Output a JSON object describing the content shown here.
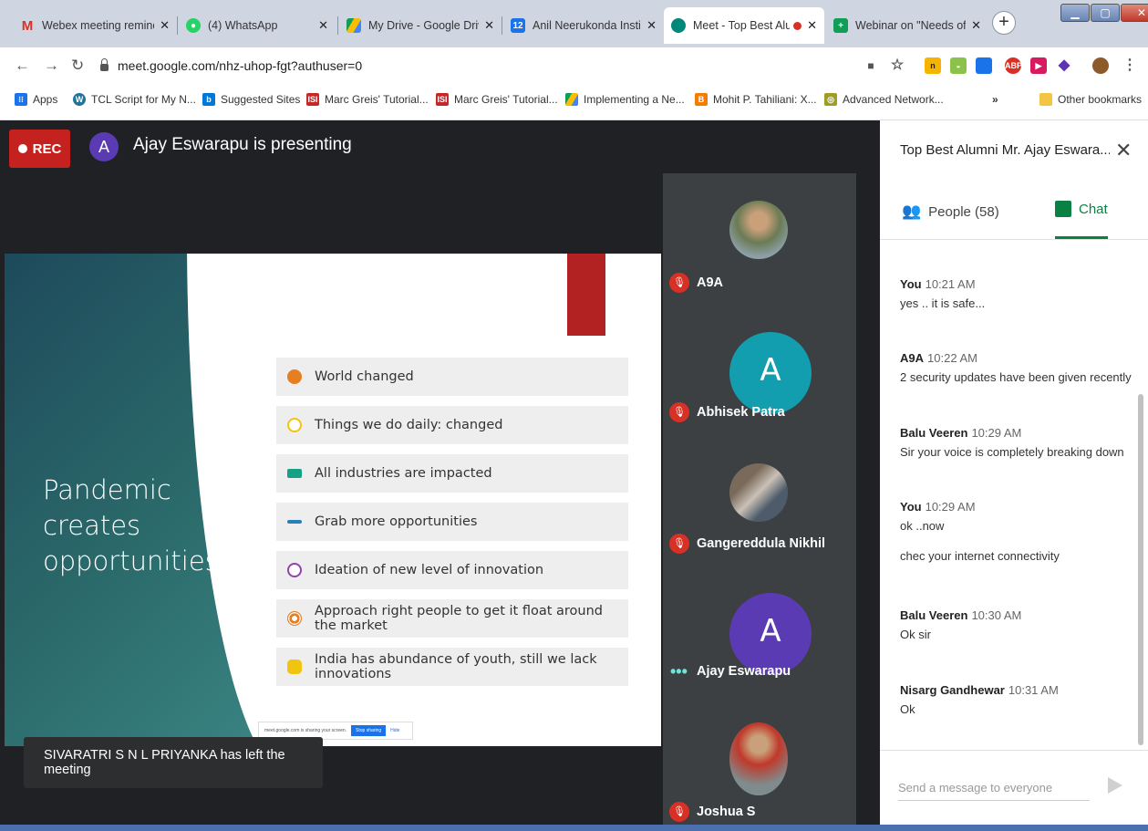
{
  "browser": {
    "tabs": [
      {
        "title": "Webex meeting reminde",
        "icon": "gmail-icon",
        "color": "#ffffff"
      },
      {
        "title": "(4) WhatsApp",
        "icon": "whatsapp-icon",
        "color": "#25d366"
      },
      {
        "title": "My Drive - Google Drive",
        "icon": "drive-icon",
        "color": "#fbbc04"
      },
      {
        "title": "Anil Neerukonda Institut",
        "icon": "calendar-icon",
        "color": "#1a73e8"
      },
      {
        "title": "Meet - Top Best Alu",
        "icon": "meet-icon",
        "color": "#00897b"
      },
      {
        "title": "Webinar on \"Needs of t",
        "icon": "classroom-icon",
        "color": "#0f9d58"
      }
    ],
    "url": "meet.google.com/nhz-uhop-fgt?authuser=0",
    "bookmarks": [
      {
        "label": "Apps"
      },
      {
        "label": "TCL Script for My N..."
      },
      {
        "label": "Suggested Sites"
      },
      {
        "label": "Marc Greis' Tutorial..."
      },
      {
        "label": "Marc Greis' Tutorial..."
      },
      {
        "label": "Implementing a Ne..."
      },
      {
        "label": "Mohit P. Tahiliani: X..."
      },
      {
        "label": "Advanced Network..."
      },
      {
        "label": "»"
      },
      {
        "label": "Other bookmarks"
      }
    ]
  },
  "meeting": {
    "rec_label": "REC",
    "presenter_initial": "A",
    "presenting_text": "Ajay Eswarapu is presenting",
    "toast": "SIVARATRI S N L PRIYANKA has left the meeting",
    "slide": {
      "title_lines": [
        "Pandemic",
        "creates",
        "opportunities"
      ],
      "bullets": [
        {
          "text": "World changed",
          "color": "#e67e22"
        },
        {
          "text": "Things we do daily: changed",
          "color": "#f1c40f"
        },
        {
          "text": "All industries are impacted",
          "color": "#16a085"
        },
        {
          "text": "Grab more opportunities",
          "color": "#2980b9"
        },
        {
          "text": "Ideation of new level of innovation",
          "color": "#8e44ad"
        },
        {
          "text": "Approach right people to get it float around the market",
          "color": "#e67e22"
        },
        {
          "text": "India has abundance of youth, still we lack innovations",
          "color": "#f1c40f"
        }
      ],
      "share_text": "meet.google.com is sharing your screen.",
      "share_stop": "Stop sharing",
      "share_hide": "Hide"
    },
    "participants": [
      {
        "name": "A9A",
        "muted": true
      },
      {
        "name": "Abhisek Patra",
        "initial": "A",
        "muted": true
      },
      {
        "name": "Gangereddula Nikhil",
        "muted": true
      },
      {
        "name": "Ajay Eswarapu",
        "initial": "A",
        "muted": false
      },
      {
        "name": "Joshua S",
        "muted": true
      }
    ]
  },
  "panel": {
    "title": "Top Best Alumni Mr. Ajay Eswara...",
    "people_tab": "People (58)",
    "chat_tab": "Chat",
    "messages": [
      {
        "sender": "You",
        "time": "10:21 AM",
        "lines": [
          "yes .. it is safe..."
        ]
      },
      {
        "sender": "A9A",
        "time": "10:22 AM",
        "lines": [
          "2 security updates have been given recently"
        ]
      },
      {
        "sender": "Balu Veeren",
        "time": "10:29 AM",
        "lines": [
          "Sir your voice is completely breaking down"
        ]
      },
      {
        "sender": "You",
        "time": "10:29 AM",
        "lines": [
          "ok ..now",
          "chec your internet connectivity"
        ]
      },
      {
        "sender": "Balu Veeren",
        "time": "10:30 AM",
        "lines": [
          "Ok sir"
        ]
      },
      {
        "sender": "Nisarg Gandhewar",
        "time": "10:31 AM",
        "lines": [
          "Ok"
        ]
      }
    ],
    "input_placeholder": "Send a message to everyone"
  }
}
